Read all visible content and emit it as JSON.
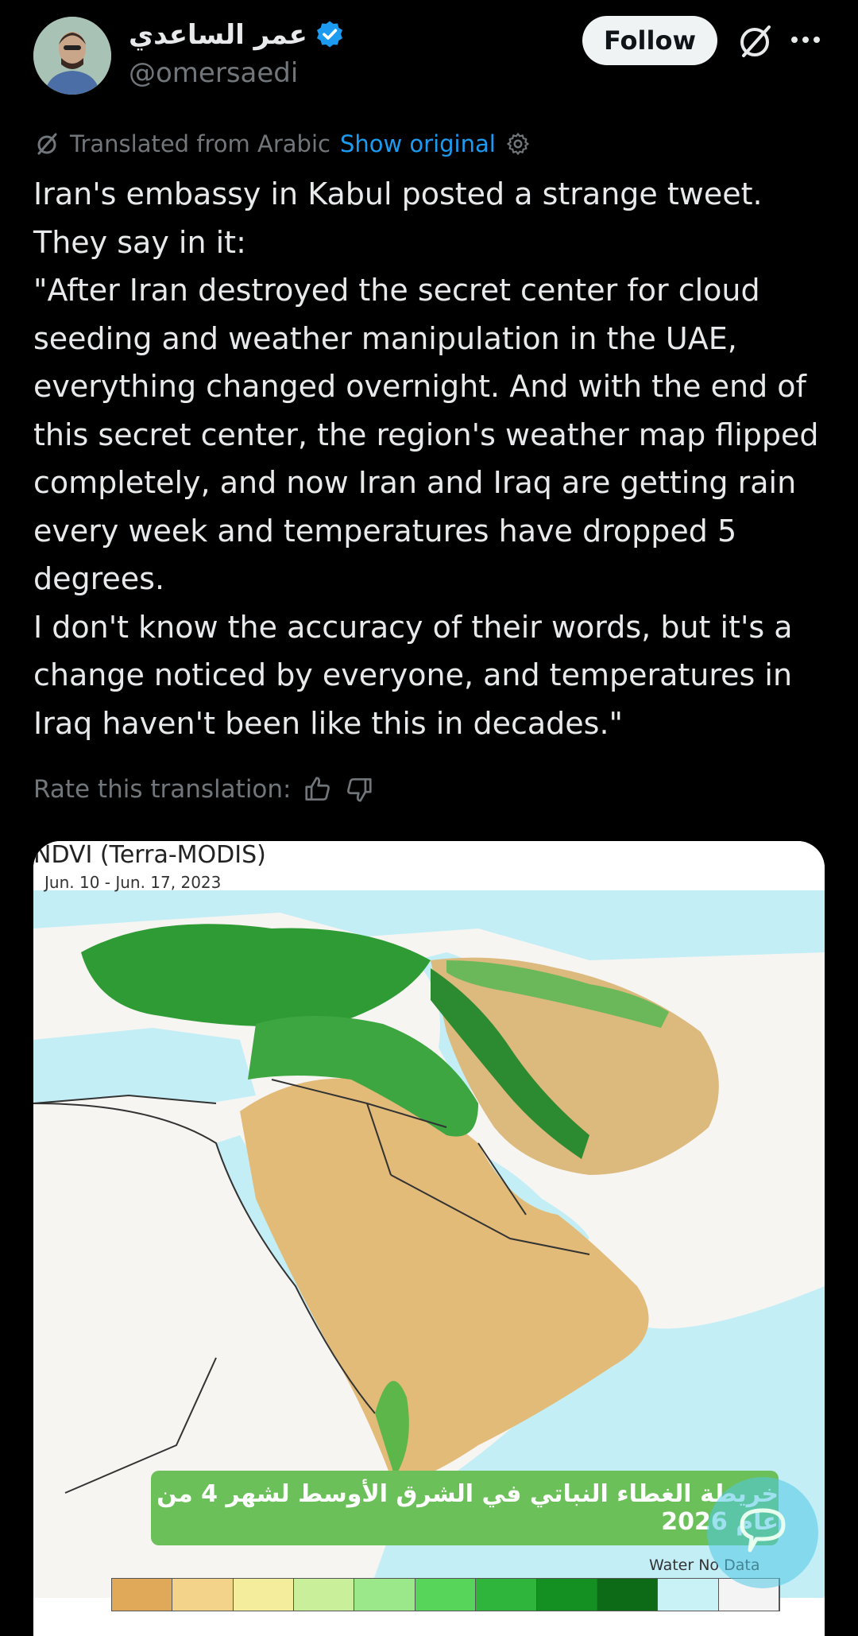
{
  "user": {
    "display_name": "عمر الساعدي",
    "handle": "@omersaedi",
    "follow_label": "Follow"
  },
  "translation": {
    "note": "Translated from Arabic",
    "show_original": "Show original",
    "rate_label": "Rate this translation:"
  },
  "tweet": {
    "lines": [
      "Iran's embassy in Kabul posted a strange tweet.",
      "They say in it:",
      "\"After Iran destroyed the secret center for cloud seeding and weather manipulation in the UAE, everything changed overnight. And with the end of this secret center, the region's weather map flipped completely, and now Iran and Iraq are getting rain every week and temperatures have dropped 5 degrees.",
      "I don't know the accuracy of their words, but it's a change noticed by everyone, and temperatures in Iraq haven't been like this in decades.\""
    ]
  },
  "media": {
    "map_title": "NDVI (Terra-MODIS)",
    "map_date": "Jun. 10 - Jun. 17, 2023",
    "caption": "خريطة الغطاء النباتي في الشرق الأوسط لشهر 4 من عام 2026",
    "legend_water": "Water",
    "legend_nodata": "No Data",
    "legend_colors": [
      "#e0a95a",
      "#f3d38a",
      "#f4ee9c",
      "#c9ef9a",
      "#9be88a",
      "#57d45a",
      "#2fb53b",
      "#148f22",
      "#0d6a16",
      "#c8f2f6",
      "#f4f4f4"
    ]
  },
  "colors": {
    "accent": "#1d9bf0",
    "muted": "#71767b",
    "text": "#e7e9ea",
    "land_dry": "#e3bd7c",
    "land_green": "#3aa43f",
    "water": "#b9ecf5"
  }
}
